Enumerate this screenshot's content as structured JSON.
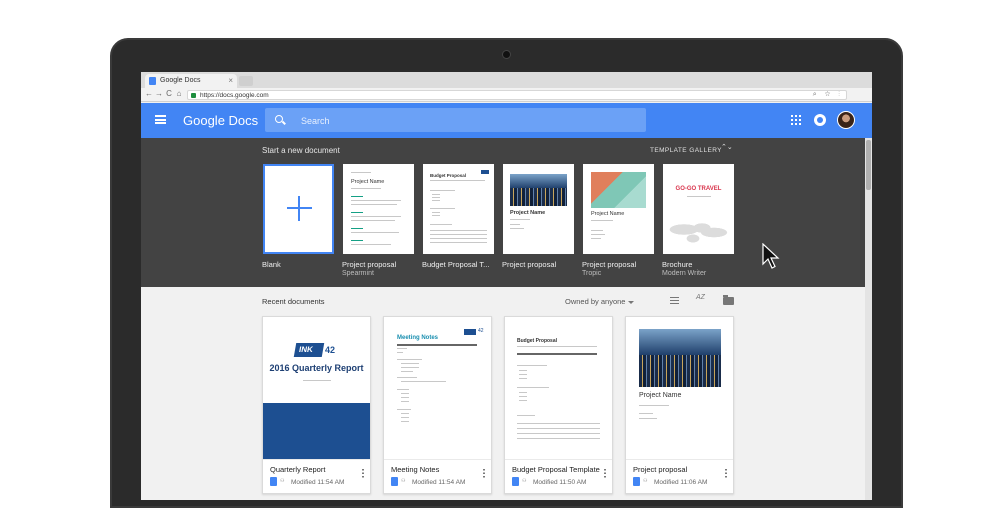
{
  "browser": {
    "tab_title": "Google Docs",
    "tab_close": "×",
    "url": "https://docs.google.com",
    "nav_back": "←",
    "nav_forward": "→",
    "nav_reload": "C",
    "nav_home": "⌂",
    "omnibox_icons": "⌕ ☆ ⋮"
  },
  "header": {
    "logo": "Google Docs",
    "search_placeholder": "Search"
  },
  "templates": {
    "section_title": "Start a new document",
    "gallery_label": "TEMPLATE GALLERY",
    "gallery_chevron": "⌃⌄",
    "items": [
      {
        "label": "Blank",
        "sub": ""
      },
      {
        "label": "Project proposal",
        "sub": "Spearmint",
        "thumb_title": "Project Name"
      },
      {
        "label": "Budget Proposal T...",
        "sub": "",
        "thumb_title": "Budget Proposal"
      },
      {
        "label": "Project proposal",
        "sub": "",
        "thumb_title": "Project Name"
      },
      {
        "label": "Project proposal",
        "sub": "Tropic",
        "thumb_title": "Project Name"
      },
      {
        "label": "Brochure",
        "sub": "Modern Writer",
        "thumb_title": "GO-GO TRAVEL"
      }
    ]
  },
  "recent": {
    "title": "Recent documents",
    "owner_filter": "Owned by anyone",
    "sort_label": "AZ",
    "docs": [
      {
        "name": "Quarterly Report",
        "modified": "Modified 11:54 AM",
        "thumb_ink": "INK",
        "thumb_num": "42",
        "thumb_title": "2016 Quarterly Report"
      },
      {
        "name": "Meeting Notes",
        "modified": "Modified 11:54 AM",
        "thumb_title": "Meeting Notes",
        "thumb_num": "42"
      },
      {
        "name": "Budget Proposal Template",
        "modified": "Modified 11:50 AM",
        "thumb_title": "Budget Proposal"
      },
      {
        "name": "Project proposal",
        "modified": "Modified 11:06 AM",
        "thumb_title": "Project Name"
      }
    ]
  },
  "colors": {
    "header_blue": "#4285f4",
    "template_bg": "#434343",
    "page_bg": "#f1f1f1",
    "ink_blue": "#1d4f91"
  }
}
